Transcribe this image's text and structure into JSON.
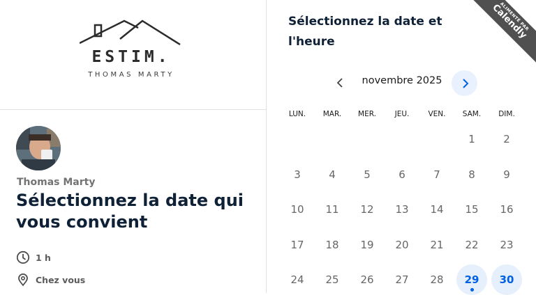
{
  "brand": {
    "logo_word": "ESTIM.",
    "logo_sub": "THOMAS MARTY"
  },
  "host": {
    "name": "Thomas Marty"
  },
  "event": {
    "title": "Sélectionnez la date qui vous convient",
    "duration": "1 h",
    "location": "Chez vous"
  },
  "calendar": {
    "heading": "Sélectionnez la date et l'heure",
    "month": "novembre 2025",
    "weekdays": [
      "LUN.",
      "MAR.",
      "MER.",
      "JEU.",
      "VEN.",
      "SAM.",
      "DIM."
    ],
    "days": {
      "d1": "1",
      "d2": "2",
      "d3": "3",
      "d4": "4",
      "d5": "5",
      "d6": "6",
      "d7": "7",
      "d8": "8",
      "d9": "9",
      "d10": "10",
      "d11": "11",
      "d12": "12",
      "d13": "13",
      "d14": "14",
      "d15": "15",
      "d16": "16",
      "d17": "17",
      "d18": "18",
      "d19": "19",
      "d20": "20",
      "d21": "21",
      "d22": "22",
      "d23": "23",
      "d24": "24",
      "d25": "25",
      "d26": "26",
      "d27": "27",
      "d28": "28",
      "d29": "29",
      "d30": "30"
    },
    "available_days": [
      29,
      30
    ]
  },
  "badge": {
    "small": "ALIMENTÉ PAR",
    "big": "Calendly"
  },
  "colors": {
    "accent": "#0060e6",
    "accent_bg": "#e6effc",
    "title_text": "#0f2137",
    "badge_bg": "#505050"
  },
  "icons": {
    "prev": "chevron-left-icon",
    "next": "chevron-right-icon",
    "duration": "clock-icon",
    "location": "map-pin-icon"
  }
}
